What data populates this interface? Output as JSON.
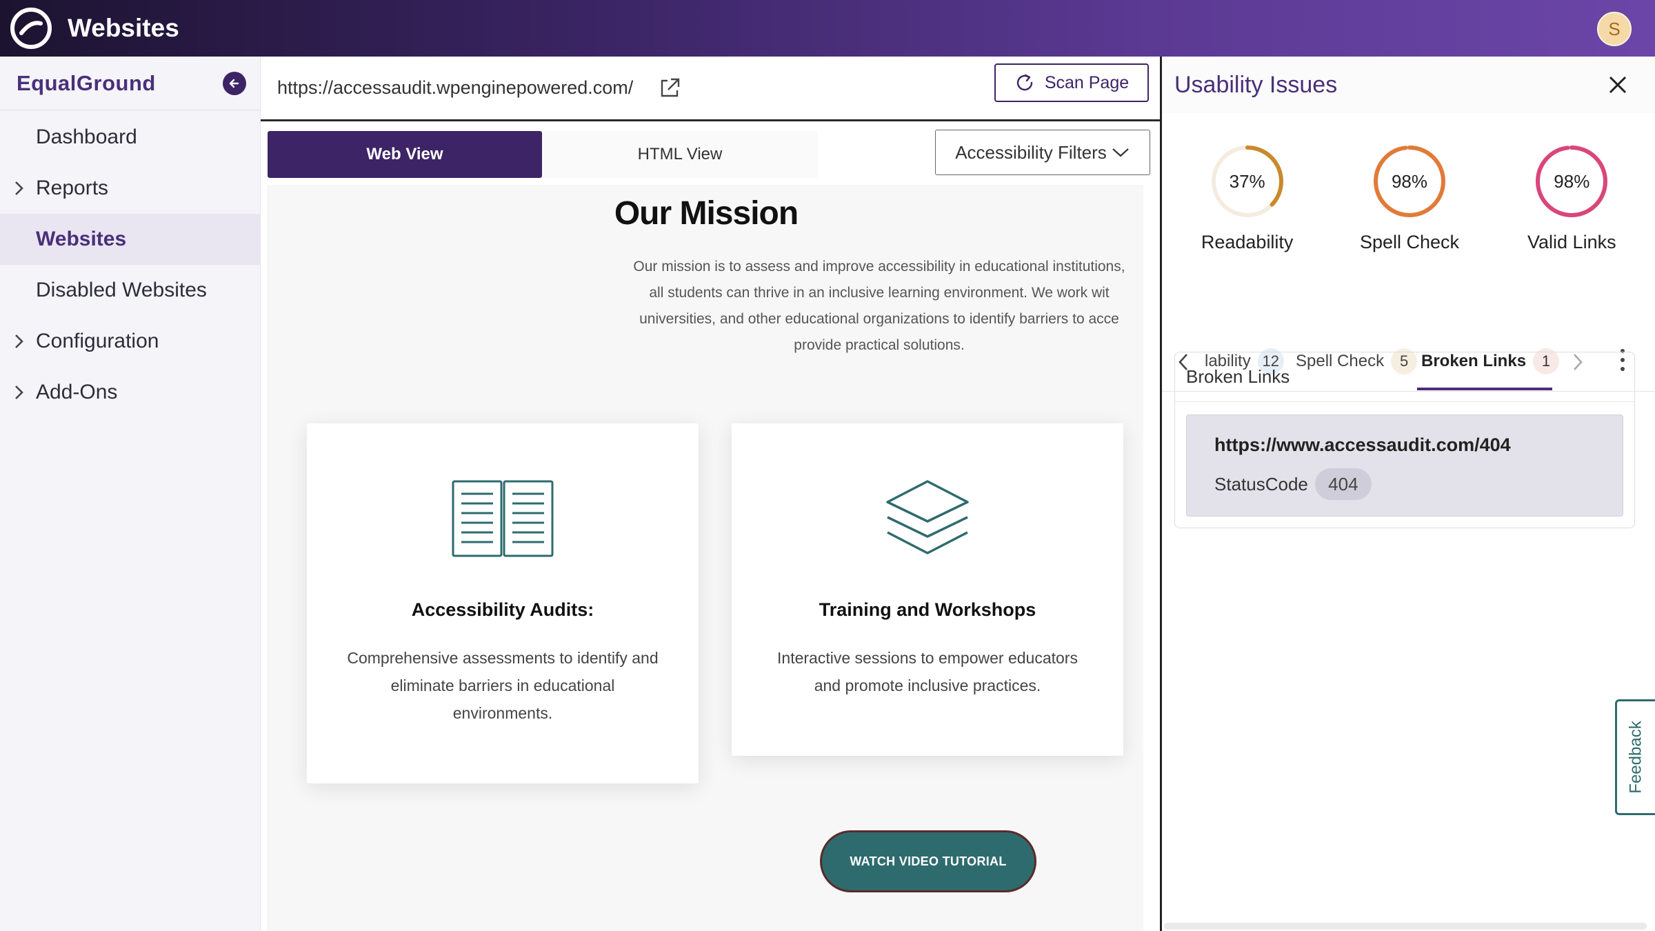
{
  "app": {
    "title": "Websites",
    "avatar_initial": "S"
  },
  "sidebar": {
    "org_name": "EqualGround",
    "items": [
      {
        "label": "Dashboard",
        "expandable": false,
        "active": false
      },
      {
        "label": "Reports",
        "expandable": true,
        "active": false
      },
      {
        "label": "Websites",
        "expandable": false,
        "active": true
      },
      {
        "label": "Disabled Websites",
        "expandable": false,
        "active": false
      },
      {
        "label": "Configuration",
        "expandable": true,
        "active": false
      },
      {
        "label": "Add-Ons",
        "expandable": true,
        "active": false
      }
    ]
  },
  "main": {
    "url": "https://accessaudit.wpenginepowered.com/",
    "scan_label": "Scan Page",
    "tabs": {
      "web": "Web View",
      "html": "HTML View"
    },
    "filters_label": "Accessibility Filters"
  },
  "preview": {
    "title": "Our Mission",
    "text_lines": [
      "Our mission is to assess and improve accessibility in educational institutions,",
      "all students can thrive in an inclusive learning environment. We work wit",
      "universities, and other educational organizations to identify barriers to acce",
      "provide practical solutions."
    ],
    "cards": [
      {
        "title": "Accessibility Audits:",
        "desc": "Comprehensive assessments to identify and eliminate barriers in educational environments."
      },
      {
        "title": "Training and Workshops",
        "desc": "Interactive sessions to empower educators and promote inclusive practices."
      }
    ],
    "button_label": "WATCH VIDEO TUTORIAL"
  },
  "panel": {
    "title": "Usability Issues",
    "gauges": [
      {
        "value": "37%",
        "percent": 37,
        "label": "Readability",
        "color": "#c98a2b"
      },
      {
        "value": "98%",
        "percent": 98,
        "label": "Spell Check",
        "color": "#e07b39"
      },
      {
        "value": "98%",
        "percent": 98,
        "label": "Valid Links",
        "color": "#d9467a"
      }
    ],
    "issue_tabs": [
      {
        "label": "lability",
        "count": "12"
      },
      {
        "label": "Spell Check",
        "count": "5"
      },
      {
        "label": "Broken Links",
        "count": "1"
      }
    ],
    "section_title": "Broken Links",
    "link": {
      "url": "https://www.accessaudit.com/404",
      "status_label": "StatusCode",
      "status_code": "404"
    }
  },
  "feedback_label": "Feedback"
}
